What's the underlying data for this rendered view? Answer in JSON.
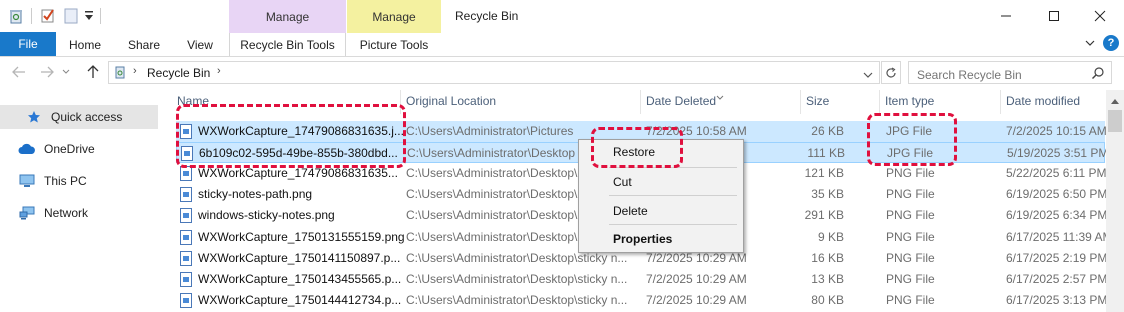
{
  "window": {
    "title": "Recycle Bin",
    "controls": {
      "minimize": "—",
      "maximize": "☐",
      "close": "✕"
    }
  },
  "ribbon": {
    "file_tab": "File",
    "tabs": [
      "Home",
      "Share",
      "View",
      "Recycle Bin Tools",
      "Picture Tools"
    ],
    "context_groups": [
      "Manage",
      "Manage"
    ],
    "help": "?"
  },
  "address": {
    "breadcrumb": "Recycle Bin",
    "search_placeholder": "Search Recycle Bin"
  },
  "sidebar": {
    "items": [
      "Quick access",
      "OneDrive",
      "This PC",
      "Network"
    ]
  },
  "columns": [
    "Name",
    "Original Location",
    "Date Deleted",
    "Size",
    "Item type",
    "Date modified"
  ],
  "files": [
    {
      "name": "WXWorkCapture_17479086831635.j...",
      "location": "C:\\Users\\Administrator\\Pictures",
      "deleted": "7/2/2025 10:58 AM",
      "size": "26 KB",
      "type": "JPG File",
      "modified": "7/2/2025 10:15 AM"
    },
    {
      "name": "6b109c02-595d-49be-855b-380dbd...",
      "location": "C:\\Users\\Administrator\\Desktop",
      "deleted": "",
      "size": "111 KB",
      "type": "JPG File",
      "modified": "5/19/2025 3:51 PM"
    },
    {
      "name": "WXWorkCapture_17479086831635...",
      "location": "C:\\Users\\Administrator\\Desktop\\",
      "deleted": "",
      "size": "121 KB",
      "type": "PNG File",
      "modified": "5/22/2025 6:11 PM"
    },
    {
      "name": "sticky-notes-path.png",
      "location": "C:\\Users\\Administrator\\Desktop\\",
      "deleted": "",
      "size": "35 KB",
      "type": "PNG File",
      "modified": "6/19/2025 6:50 PM"
    },
    {
      "name": "windows-sticky-notes.png",
      "location": "C:\\Users\\Administrator\\Desktop\\",
      "deleted": "",
      "size": "291 KB",
      "type": "PNG File",
      "modified": "6/19/2025 6:34 PM"
    },
    {
      "name": "WXWorkCapture_1750131555159.png",
      "location": "C:\\Users\\Administrator\\Desktop\\",
      "deleted": "",
      "size": "9 KB",
      "type": "PNG File",
      "modified": "6/17/2025 11:39 AM"
    },
    {
      "name": "WXWorkCapture_1750141150897.p...",
      "location": "C:\\Users\\Administrator\\Desktop\\sticky n...",
      "deleted": "7/2/2025 10:29 AM",
      "size": "16 KB",
      "type": "PNG File",
      "modified": "6/17/2025 2:19 PM"
    },
    {
      "name": "WXWorkCapture_1750143455565.p...",
      "location": "C:\\Users\\Administrator\\Desktop\\sticky n...",
      "deleted": "7/2/2025 10:29 AM",
      "size": "13 KB",
      "type": "PNG File",
      "modified": "6/17/2025 2:57 PM"
    },
    {
      "name": "WXWorkCapture_1750144412734.p...",
      "location": "C:\\Users\\Administrator\\Desktop\\sticky n...",
      "deleted": "7/2/2025 10:29 AM",
      "size": "80 KB",
      "type": "PNG File",
      "modified": "6/17/2025 3:13 PM"
    }
  ],
  "context_menu": {
    "restore": "Restore",
    "cut": "Cut",
    "delete": "Delete",
    "properties": "Properties"
  },
  "colors": {
    "accent": "#1979ca",
    "selection": "#cce8ff",
    "annotation": "#e0103e",
    "manage_purple": "#e8d5f5",
    "manage_yellow": "#f4f1a0"
  }
}
